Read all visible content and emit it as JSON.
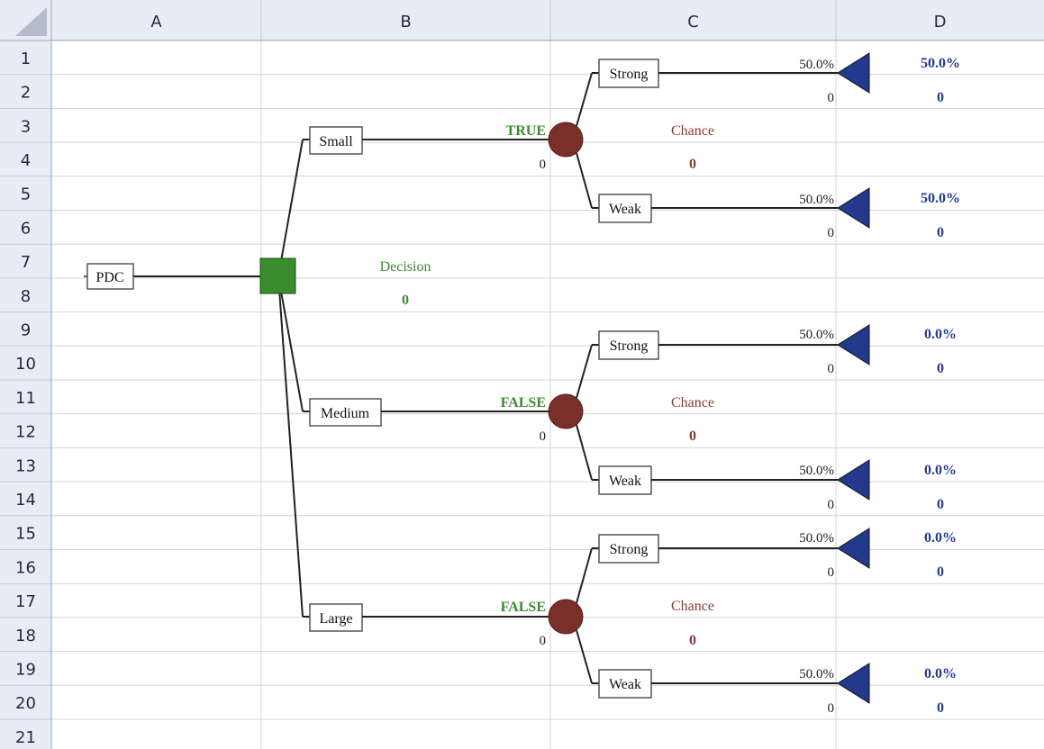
{
  "columns": [
    "A",
    "B",
    "C",
    "D"
  ],
  "rows": [
    "1",
    "2",
    "3",
    "4",
    "5",
    "6",
    "7",
    "8",
    "9",
    "10",
    "11",
    "12",
    "13",
    "14",
    "15",
    "16",
    "17",
    "18",
    "19",
    "20",
    "21"
  ],
  "colors": {
    "grid": "#d4d4d4",
    "header_bg": "#e8edf5",
    "decision_node": "#3a8c2e",
    "chance_node": "#7a2f2a",
    "terminal_node": "#233a8c"
  },
  "tree": {
    "root": {
      "label": "PDC"
    },
    "decision": {
      "title": "Decision",
      "value": "0"
    },
    "branches": [
      {
        "label": "Small",
        "flag": "TRUE",
        "value": "0",
        "chance": {
          "title": "Chance",
          "value": "0"
        },
        "outcomes": [
          {
            "label": "Strong",
            "prob": "50.0%",
            "value": "0",
            "result_prob": "50.0%",
            "result_value": "0"
          },
          {
            "label": "Weak",
            "prob": "50.0%",
            "value": "0",
            "result_prob": "50.0%",
            "result_value": "0"
          }
        ]
      },
      {
        "label": "Medium",
        "flag": "FALSE",
        "value": "0",
        "chance": {
          "title": "Chance",
          "value": "0"
        },
        "outcomes": [
          {
            "label": "Strong",
            "prob": "50.0%",
            "value": "0",
            "result_prob": "0.0%",
            "result_value": "0"
          },
          {
            "label": "Weak",
            "prob": "50.0%",
            "value": "0",
            "result_prob": "0.0%",
            "result_value": "0"
          }
        ]
      },
      {
        "label": "Large",
        "flag": "FALSE",
        "value": "0",
        "chance": {
          "title": "Chance",
          "value": "0"
        },
        "outcomes": [
          {
            "label": "Strong",
            "prob": "50.0%",
            "value": "0",
            "result_prob": "0.0%",
            "result_value": "0"
          },
          {
            "label": "Weak",
            "prob": "50.0%",
            "value": "0",
            "result_prob": "0.0%",
            "result_value": "0"
          }
        ]
      }
    ]
  }
}
